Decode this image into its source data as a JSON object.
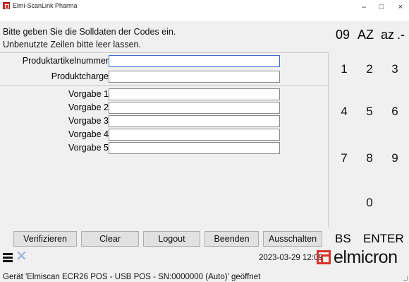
{
  "window": {
    "title": "Elmi-ScanLink Pharma",
    "minimize": "–",
    "maximize": "□",
    "close": "×"
  },
  "instructions": {
    "line1": "Bitte geben Sie die Solldaten der Codes ein.",
    "line2": "Unbenutzte Zeilen bitte leer lassen."
  },
  "fields": [
    {
      "label": "Produktartikelnummer",
      "value": ""
    },
    {
      "label": "Produktcharge",
      "value": ""
    },
    {
      "label": "Vorgabe 1",
      "value": ""
    },
    {
      "label": "Vorgabe 2",
      "value": ""
    },
    {
      "label": "Vorgabe 3",
      "value": ""
    },
    {
      "label": "Vorgabe 4",
      "value": ""
    },
    {
      "label": "Vorgabe 5",
      "value": ""
    }
  ],
  "keypad": {
    "mode_digits": "09",
    "mode_upper": "AZ",
    "mode_lower": "az",
    "mode_special": ".-",
    "keys": [
      "1",
      "2",
      "3",
      "4",
      "5",
      "6",
      "7",
      "8",
      "9",
      "0"
    ],
    "backspace": "BS",
    "enter": "ENTER"
  },
  "buttons": {
    "verify": "Verifizieren",
    "clear": "Clear",
    "logout": "Logout",
    "quit": "Beenden",
    "shutdown": "Ausschalten"
  },
  "status": {
    "datetime": "2023-03-29 12:09",
    "logo": "elmicron",
    "device": "Gerät 'Elmiscan ECR26 POS - USB POS - SN:0000000 (Auto)' geöffnet"
  },
  "icons": {
    "menu": "hamburger-menu-icon",
    "close": "close-x-icon",
    "app": "app-icon"
  },
  "colors": {
    "brand_red": "#d9342b",
    "x_icon": "#8fb0e0"
  }
}
